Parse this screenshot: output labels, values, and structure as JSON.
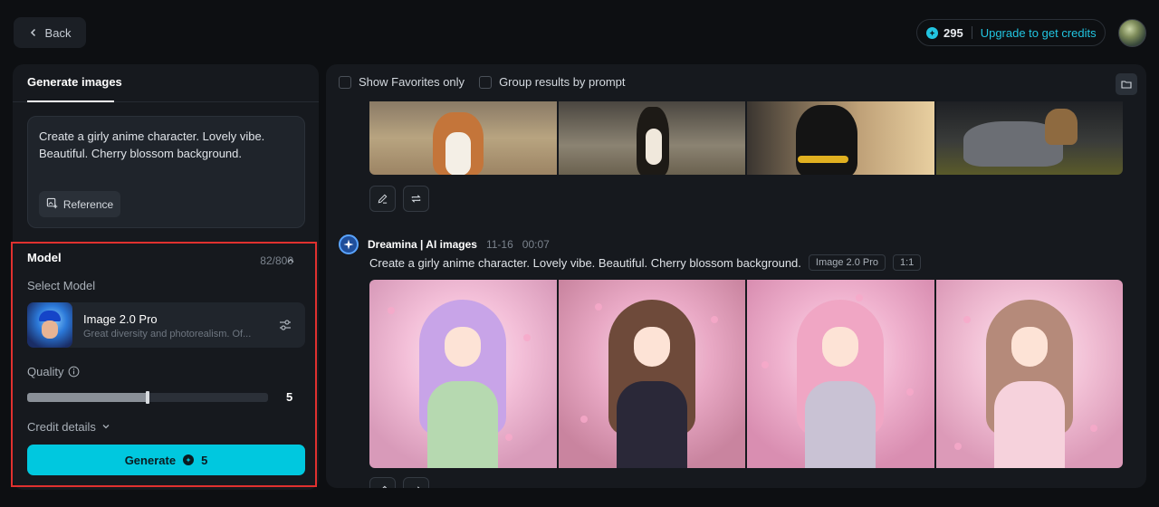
{
  "header": {
    "back_label": "Back",
    "credits_count": "295",
    "upgrade_label": "Upgrade to get credits"
  },
  "left_panel": {
    "tab_label": "Generate images",
    "prompt_text": "Create a girly anime character. Lovely vibe. Beautiful. Cherry blossom background.",
    "reference_label": "Reference",
    "char_count": "82/800",
    "model_section_title": "Model",
    "select_model_label": "Select Model",
    "model_name": "Image 2.0 Pro",
    "model_description": "Great diversity and photorealism. Of...",
    "quality_label": "Quality",
    "quality_value": "5",
    "quality_fraction": 0.5,
    "credit_details_label": "Credit details",
    "generate_label": "Generate",
    "generate_cost": "5"
  },
  "right_panel": {
    "filters": [
      {
        "label": "Show Favorites only"
      },
      {
        "label": "Group results by prompt"
      }
    ],
    "generation": {
      "brand": "Dreamina | AI images",
      "date": "11-16",
      "time": "00:07",
      "prompt": "Create a girly anime character. Lovely vibe. Beautiful. Cherry blossom background.",
      "tags": [
        "Image 2.0 Pro",
        "1:1"
      ]
    }
  },
  "colors": {
    "accent": "#00c8df",
    "highlight_border": "#e0312f",
    "panel_bg": "#16191e",
    "page_bg": "#0d0f12"
  },
  "icons": {
    "back": "chevron-left-icon",
    "credit": "coin-icon",
    "reference": "image-add-icon",
    "collapse": "chevron-up-icon",
    "model_settings": "sliders-icon",
    "quality_info": "info-icon",
    "credit_details": "chevron-down-icon",
    "folder": "folder-icon",
    "edit": "pencil-icon",
    "regenerate": "repeat-icon",
    "brand": "sparkle-icon"
  }
}
